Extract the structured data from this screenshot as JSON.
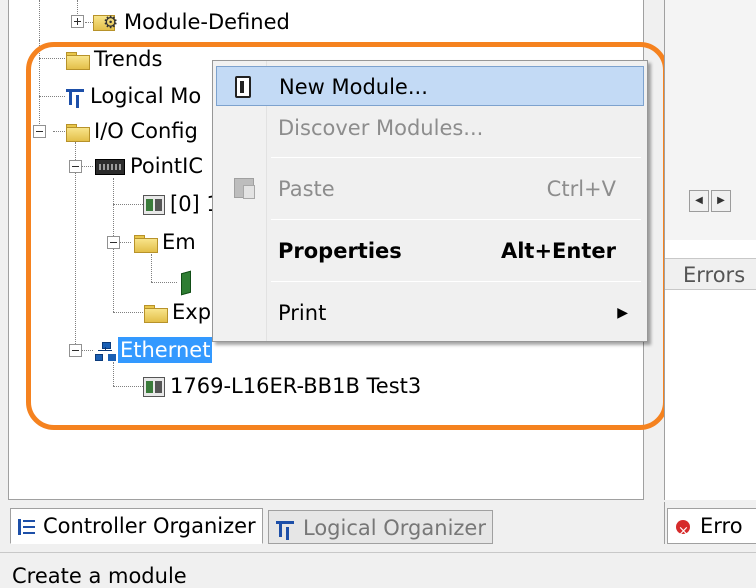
{
  "tree": {
    "module_defined": "Module-Defined",
    "trends": "Trends",
    "logical_model": "Logical Mo",
    "io_config": "I/O Config",
    "pointio": "PointIC",
    "slot0": "[0] 1",
    "embedded": "Em",
    "expansion": "Exp",
    "ethernet": "Ethernet",
    "controller": "1769-L16ER-BB1B Test3"
  },
  "context_menu": {
    "new_module": "New Module...",
    "discover_modules": "Discover Modules...",
    "paste": "Paste",
    "paste_shortcut": "Ctrl+V",
    "properties": "Properties",
    "properties_shortcut": "Alt+Enter",
    "print": "Print"
  },
  "right_pane": {
    "errors_header": "Errors",
    "errors_tab": "Erro"
  },
  "tabs": {
    "controller_organizer": "Controller Organizer",
    "logical_organizer": "Logical Organizer"
  },
  "status_bar": {
    "text": "Create a module"
  },
  "colors": {
    "highlight": "#f5821f",
    "selection": "#3399ff",
    "menu_hover": "#c3daf5"
  }
}
